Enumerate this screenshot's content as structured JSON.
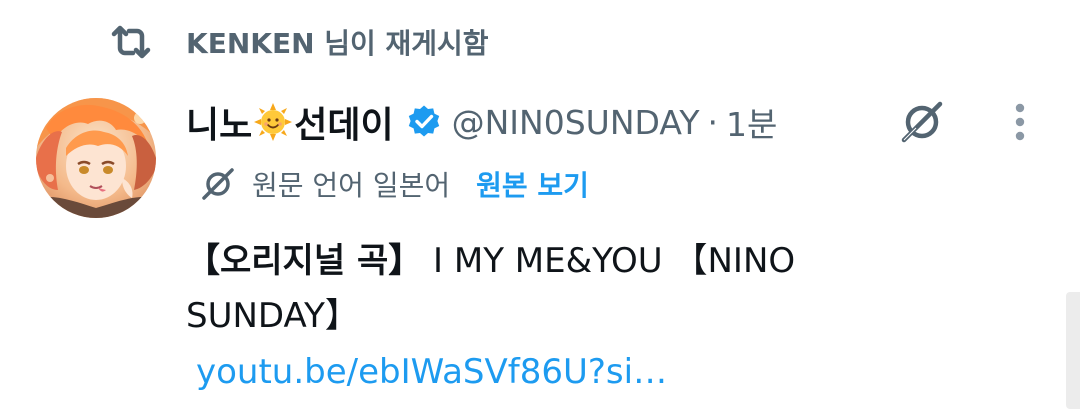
{
  "retweet": {
    "icon": "retweet-icon",
    "text": "KENKEN 님이 재게시함"
  },
  "author": {
    "name_part1": "니노",
    "name_emoji": "sun-with-face-emoji",
    "name_part2": "선데이",
    "verified_icon": "verified-badge-icon",
    "handle": "@NIN0SUNDAY",
    "separator": "·",
    "time": "1분",
    "avatar": "avatar"
  },
  "actions": {
    "grok_icon": "grok-icon",
    "more_icon": "more-vertical-icon"
  },
  "translation": {
    "icon": "grok-translate-icon",
    "note": "원문 언어 일본어",
    "show_original": "원본 보기"
  },
  "tweet": {
    "title": "【오리지널 곡】",
    "body": " I MY ME&YOU 【NINO SUNDAY】",
    "link": "youtu.be/ebIWaSVf86U?si…"
  },
  "colors": {
    "accent": "#1d9bf0",
    "secondary_text": "#536471",
    "primary_text": "#0f1419"
  }
}
